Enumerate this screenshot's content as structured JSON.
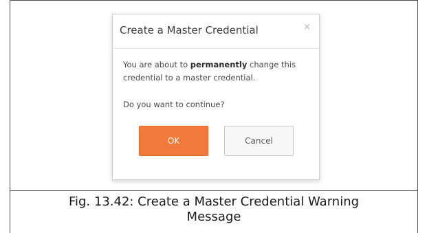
{
  "dialog": {
    "title": "Create a Master Credential",
    "close_symbol": "×",
    "message_prefix": "You are about to ",
    "message_bold": "permanently",
    "message_suffix": " change this credential to a master credential.",
    "question": "Do you want to continue?",
    "ok_label": "OK",
    "cancel_label": "Cancel"
  },
  "caption": {
    "line1": "Fig. 13.42: Create a Master Credential Warning",
    "line2": "Message"
  },
  "colors": {
    "ok_button": "#f2793c",
    "cancel_button": "#f7f7f7"
  }
}
